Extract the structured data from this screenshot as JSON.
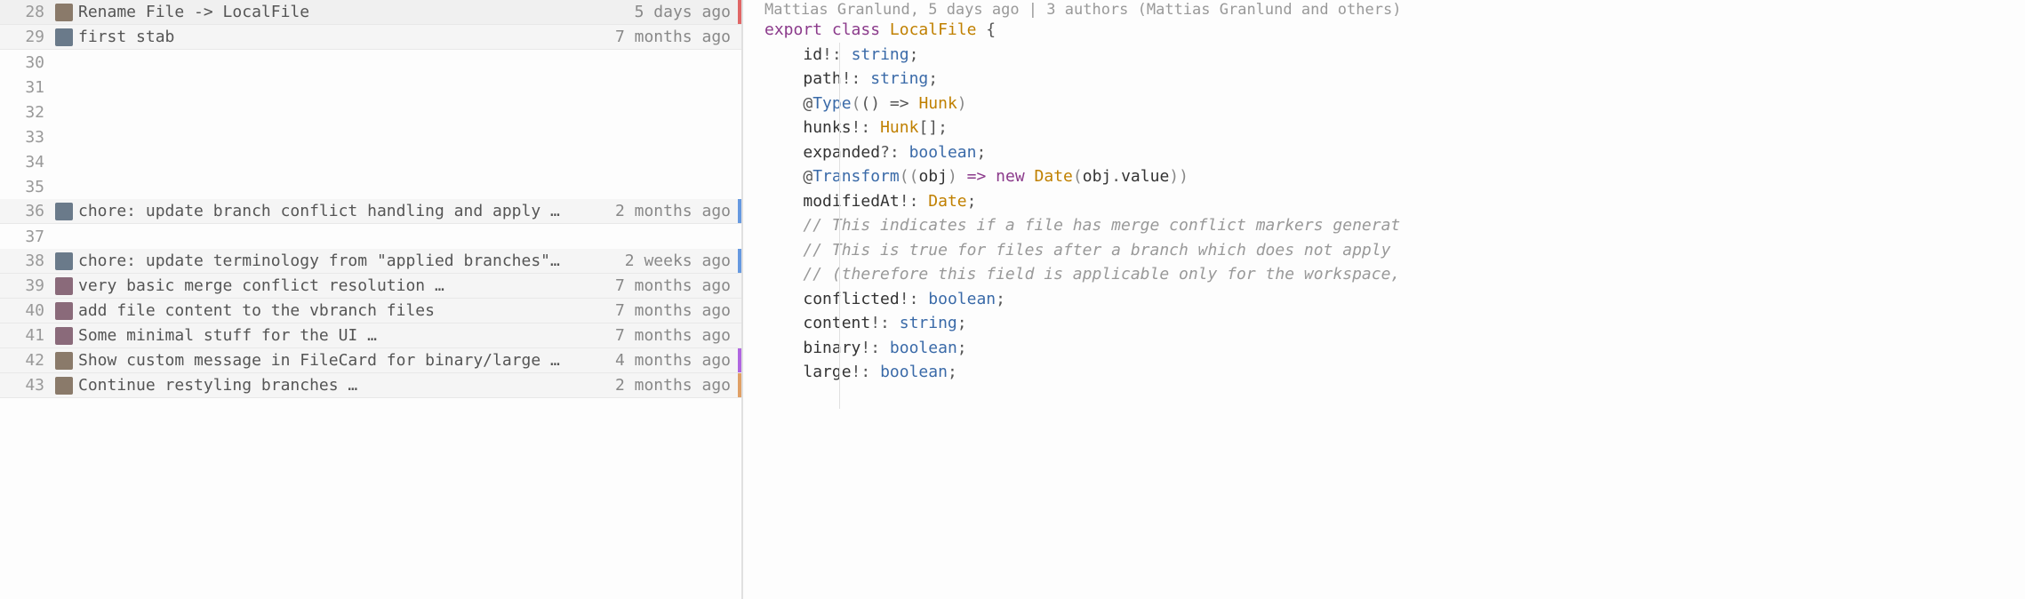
{
  "blame": [
    {
      "line": 28,
      "avatar": "a1",
      "msg": "Rename File -> LocalFile",
      "date": "5 days ago",
      "highlighted": true,
      "indicator": "red"
    },
    {
      "line": 29,
      "avatar": "a2",
      "msg": "first stab",
      "date": "7 months ago",
      "indicator": ""
    },
    {
      "line": 30,
      "empty": true
    },
    {
      "line": 31,
      "empty": true
    },
    {
      "line": 32,
      "empty": true
    },
    {
      "line": 33,
      "empty": true
    },
    {
      "line": 34,
      "empty": true
    },
    {
      "line": 35,
      "empty": true
    },
    {
      "line": 36,
      "avatar": "a2",
      "msg": "chore: update branch conflict handling and apply …",
      "date": "2 months ago",
      "indicator": "blue"
    },
    {
      "line": 37,
      "empty": true
    },
    {
      "line": 38,
      "avatar": "a2",
      "msg": "chore: update terminology from \"applied branches\"…",
      "date": "2 weeks ago",
      "indicator": "blue"
    },
    {
      "line": 39,
      "avatar": "a3",
      "msg": "very basic merge conflict resolution …",
      "date": "7 months ago",
      "indicator": ""
    },
    {
      "line": 40,
      "avatar": "a3",
      "msg": "add file content to the vbranch files",
      "date": "7 months ago",
      "indicator": ""
    },
    {
      "line": 41,
      "avatar": "a3",
      "msg": "Some minimal stuff for the UI …",
      "date": "7 months ago",
      "indicator": ""
    },
    {
      "line": 42,
      "avatar": "a1",
      "msg": "Show custom message in FileCard for binary/large …",
      "date": "4 months ago",
      "indicator": "purple"
    },
    {
      "line": 43,
      "avatar": "a1",
      "msg": "Continue restyling branches …",
      "date": "2 months ago",
      "indicator": "orange"
    }
  ],
  "codeHeader": "Mattias Granlund, 5 days ago | 3 authors (Mattias Granlund and others)",
  "code": {
    "l1": {
      "export": "export",
      "class": "class",
      "name": "LocalFile",
      "brace": "{"
    },
    "l2": {
      "prop": "id",
      "bang": "!:",
      "type": "string",
      "semi": ";"
    },
    "l3": {
      "prop": "path",
      "bang": "!:",
      "type": "string",
      "semi": ";"
    },
    "l4": {
      "at": "@",
      "dec": "Type",
      "open": "(",
      "arrow": "() =>",
      "type": "Hunk",
      "close": ")"
    },
    "l5": {
      "prop": "hunks",
      "bang": "!:",
      "type": "Hunk",
      "arr": "[]",
      "semi": ";"
    },
    "l6": {
      "prop": "expanded",
      "bang": "?:",
      "type": "boolean",
      "semi": ";"
    },
    "l7": {
      "at": "@",
      "dec": "Transform",
      "open": "((",
      "param": "obj",
      "close1": ")",
      "arrow": "=>",
      "new": "new",
      "date": "Date",
      "open2": "(",
      "obj": "obj",
      "dot": ".",
      "val": "value",
      "close2": "))"
    },
    "l8": {
      "prop": "modifiedAt",
      "bang": "!:",
      "type": "Date",
      "semi": ";"
    },
    "l9": {
      "comment": "// This indicates if a file has merge conflict markers generat"
    },
    "l10": {
      "comment": "// This is true for files after a branch which does not apply "
    },
    "l11": {
      "comment": "// (therefore this field is applicable only for the workspace,"
    },
    "l12": {
      "prop": "conflicted",
      "bang": "!:",
      "type": "boolean",
      "semi": ";"
    },
    "l13": {
      "prop": "content",
      "bang": "!:",
      "type": "string",
      "semi": ";"
    },
    "l14": {
      "prop": "binary",
      "bang": "!:",
      "type": "boolean",
      "semi": ";"
    },
    "l15": {
      "prop": "large",
      "bang": "!:",
      "type": "boolean",
      "semi": ";"
    }
  }
}
